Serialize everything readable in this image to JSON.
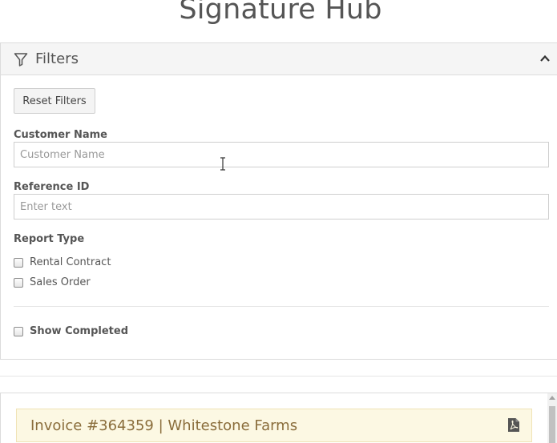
{
  "page": {
    "title": "Signature Hub"
  },
  "filters": {
    "header_label": "Filters",
    "reset_label": "Reset Filters",
    "customer_name": {
      "label": "Customer Name",
      "value": "",
      "placeholder": "Customer Name"
    },
    "reference_id": {
      "label": "Reference ID",
      "value": "",
      "placeholder": "Enter text"
    },
    "report_type": {
      "label": "Report Type",
      "options": [
        {
          "label": "Rental Contract",
          "checked": false
        },
        {
          "label": "Sales Order",
          "checked": false
        }
      ]
    },
    "show_completed": {
      "label": "Show Completed",
      "checked": false
    }
  },
  "results": {
    "items": [
      {
        "title": "Invoice #364359 | Whitestone Farms",
        "icon": "pdf-file-icon"
      }
    ]
  },
  "icons": {
    "filter": "funnel-icon",
    "collapse": "chevron-up-icon",
    "pdf": "pdf-file-icon",
    "cursor": "text-cursor-icon"
  },
  "colors": {
    "card_background": "#fcf8e3",
    "card_text": "#8a6d3b",
    "header_background": "#f5f5f5",
    "border": "#dcdcdc"
  }
}
